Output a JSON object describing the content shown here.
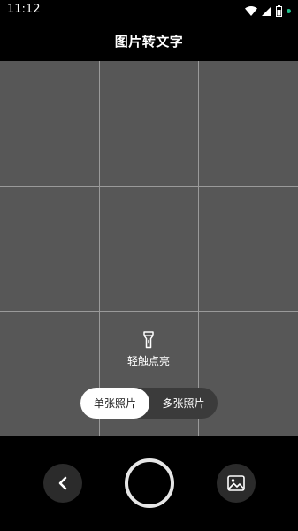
{
  "status_bar": {
    "time": "11:12",
    "icons": [
      "wifi-icon",
      "signal-icon",
      "battery-icon",
      "notification-dot"
    ]
  },
  "header": {
    "title": "图片转文字"
  },
  "camera": {
    "grid": "3x3",
    "flash_label": "轻触点亮",
    "flash_icon": "flashlight-icon"
  },
  "mode_switch": {
    "options": [
      {
        "label": "单张照片",
        "selected": true
      },
      {
        "label": "多张照片",
        "selected": false
      }
    ]
  },
  "controls": {
    "back_icon": "chevron-left-icon",
    "shutter": "shutter-button",
    "gallery_icon": "image-icon"
  },
  "colors": {
    "background": "#000000",
    "viewfinder": "#575757",
    "grid_line": "#9a9a9a",
    "mode_active_bg": "#ffffff",
    "mode_track_bg": "#3b3b3b",
    "status_dot": "#21c08b"
  }
}
